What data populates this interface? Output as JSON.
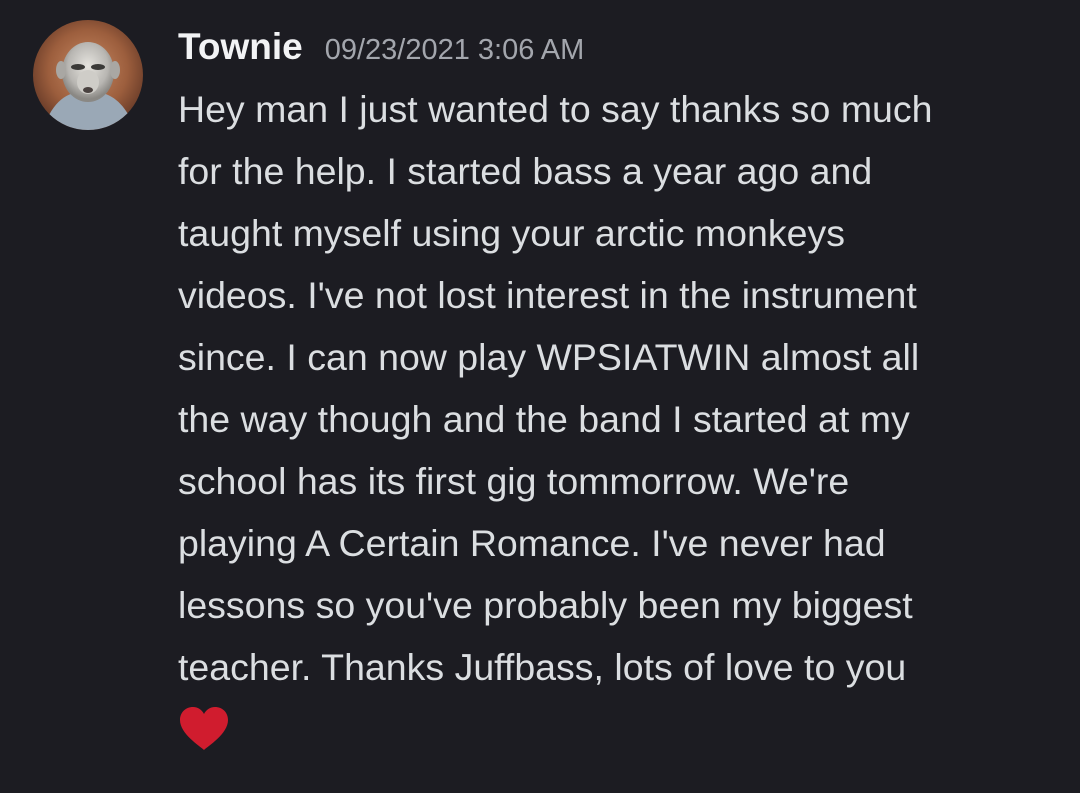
{
  "message": {
    "author": "Townie",
    "timestamp": "09/23/2021 3:06 AM",
    "body_lines": [
      "Hey man I just wanted to say thanks so much",
      "for the help. I started bass a year ago and",
      "taught myself using your arctic monkeys",
      "videos. I've not lost interest in the instrument",
      "since. I can now play WPSIATWIN almost all",
      "the way though and the band I started at my",
      "school has its first gig tommorrow. We're",
      "playing A Certain Romance. I've never had",
      "lessons so you've probably been my biggest",
      "teacher. Thanks Juffbass, lots of love to you"
    ],
    "emoji": "red-heart-icon"
  },
  "colors": {
    "background": "#1c1c22",
    "username": "#f2f3f5",
    "timestamp": "#a3a6ad",
    "body_text": "#dbdee1",
    "heart": "#d01c2e"
  }
}
